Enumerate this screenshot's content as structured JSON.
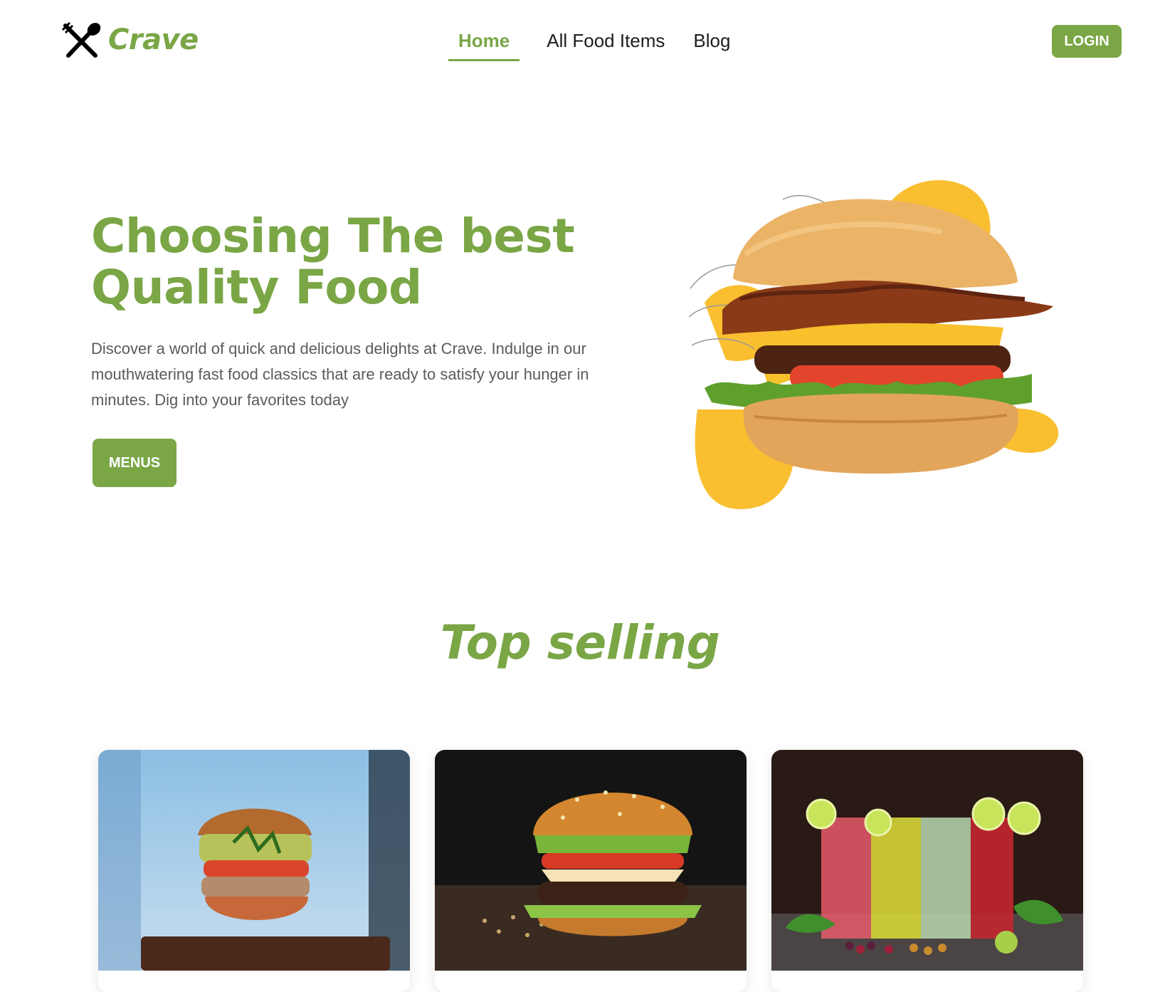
{
  "brand": {
    "name": "Crave"
  },
  "nav": {
    "items": [
      {
        "label": "Home",
        "active": true
      },
      {
        "label": "All Food Items",
        "active": false
      },
      {
        "label": "Blog",
        "active": false
      }
    ]
  },
  "header": {
    "login_label": "LOGIN"
  },
  "hero": {
    "title": "Choosing The best Quality Food",
    "description": "Discover a world of quick and delicious delights at Crave. Indulge in our mouthwatering fast food classics that are ready to satisfy your hunger in minutes. Dig into your favorites today",
    "cta_label": "MENUS"
  },
  "top_selling": {
    "title": "Top selling"
  },
  "colors": {
    "accent": "#7aa646",
    "blob": "#f9bf30",
    "text_muted": "#5b5b5b"
  }
}
